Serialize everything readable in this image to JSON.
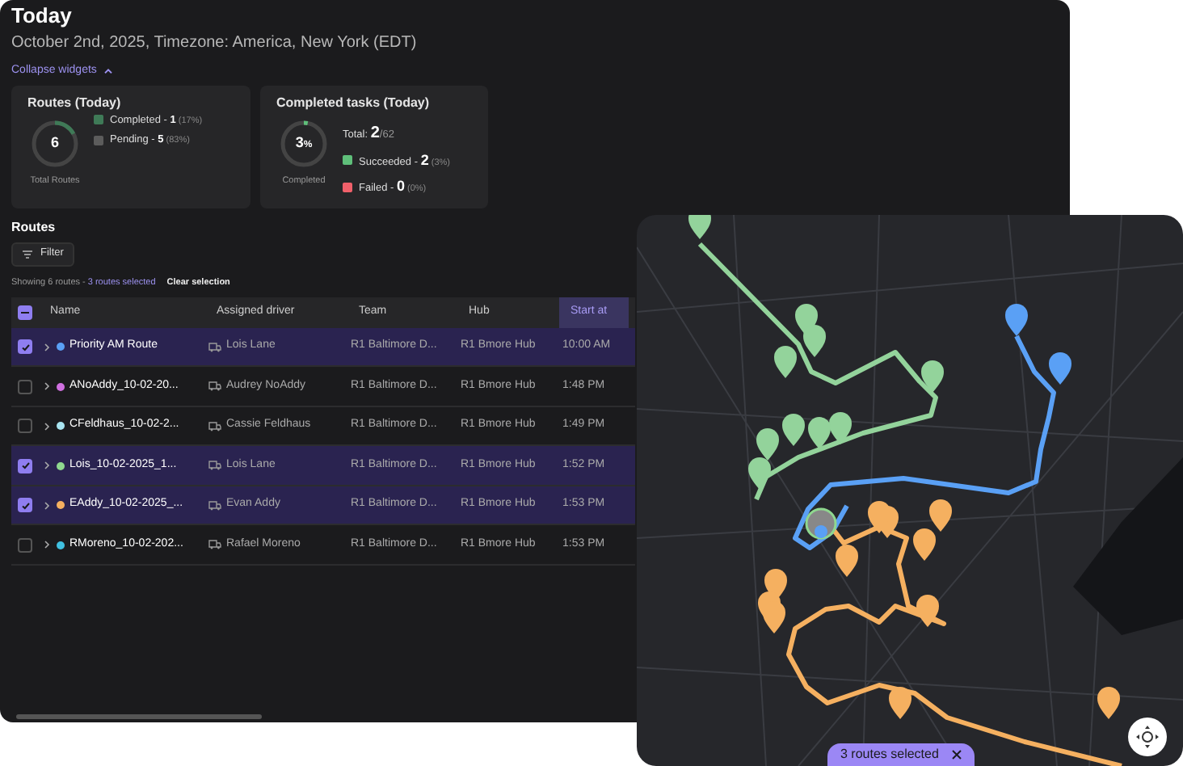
{
  "header": {
    "title": "Today",
    "subtitle": "October 2nd, 2025, Timezone: America, New York (EDT)",
    "collapse_link": "Collapse widgets"
  },
  "widgets": [
    {
      "kind": "routes",
      "title": "Routes (Today)",
      "ring_value": "6",
      "ring_caption": "Total Routes",
      "level": 0.17,
      "legend": [
        {
          "label": "Completed - ",
          "value": "1",
          "pct": "(17%)",
          "color": "#3f7a57"
        },
        {
          "label": "Pending - ",
          "value": "5",
          "pct": "(83%)",
          "color": "#5c5c5c"
        }
      ]
    },
    {
      "kind": "tasks",
      "title": "Completed tasks (Today)",
      "ring_value": "3",
      "ring_unit": "%",
      "ring_caption": "Completed",
      "level": 0.03,
      "total_label": "Total: ",
      "total_value": "2",
      "total_of": "/62",
      "legend": [
        {
          "label": "Succeeded - ",
          "value": "2",
          "pct": "(3%)",
          "color": "#5fbf7a"
        },
        {
          "label": "Failed - ",
          "value": "0",
          "pct": "(0%)",
          "color": "#f0606a"
        }
      ]
    }
  ],
  "routes": {
    "title": "Routes",
    "filter_button": "Filter",
    "summary": "Showing 6 routes - ",
    "selected_link": "3 routes selected",
    "clear_button": "Clear selection",
    "header_checkbox_indeterminate": true,
    "columns": [
      {
        "label": "Name",
        "sorted": false
      },
      {
        "label": "Assigned driver",
        "sorted": false
      },
      {
        "label": "Team",
        "sorted": false
      },
      {
        "label": "Hub",
        "sorted": false
      },
      {
        "label": "Start at",
        "sorted": true
      }
    ],
    "rows": [
      {
        "selected": true,
        "color": "#5aa0f5",
        "name": "Priority AM Route",
        "driver": "Lois Lane",
        "team": "R1 Baltimore D...",
        "hub": "R1 Bmore Hub",
        "start": "10:00 AM"
      },
      {
        "selected": false,
        "color": "#d070e0",
        "name": "ANoAddy_10-02-20...",
        "driver": "Audrey NoAddy",
        "team": "R1 Baltimore D...",
        "hub": "R1 Bmore Hub",
        "start": "1:48 PM"
      },
      {
        "selected": false,
        "color": "#a8e4f0",
        "name": "CFeldhaus_10-02-2...",
        "driver": "Cassie Feldhaus",
        "team": "R1 Baltimore D...",
        "hub": "R1 Bmore Hub",
        "start": "1:49 PM"
      },
      {
        "selected": true,
        "color": "#8fd88f",
        "name": "Lois_10-02-2025_1...",
        "driver": "Lois Lane",
        "team": "R1 Baltimore D...",
        "hub": "R1 Bmore Hub",
        "start": "1:52 PM"
      },
      {
        "selected": true,
        "color": "#f5b060",
        "name": "EAddy_10-02-2025_...",
        "driver": "Evan Addy",
        "team": "R1 Baltimore D...",
        "hub": "R1 Bmore Hub",
        "start": "1:53 PM"
      },
      {
        "selected": false,
        "color": "#40c0e0",
        "name": "RMoreno_10-02-202...",
        "driver": "Rafael Moreno",
        "team": "R1 Baltimore D...",
        "hub": "R1 Bmore Hub",
        "start": "1:53 PM"
      }
    ]
  },
  "map": {
    "selection_chip": "3 routes selected"
  }
}
